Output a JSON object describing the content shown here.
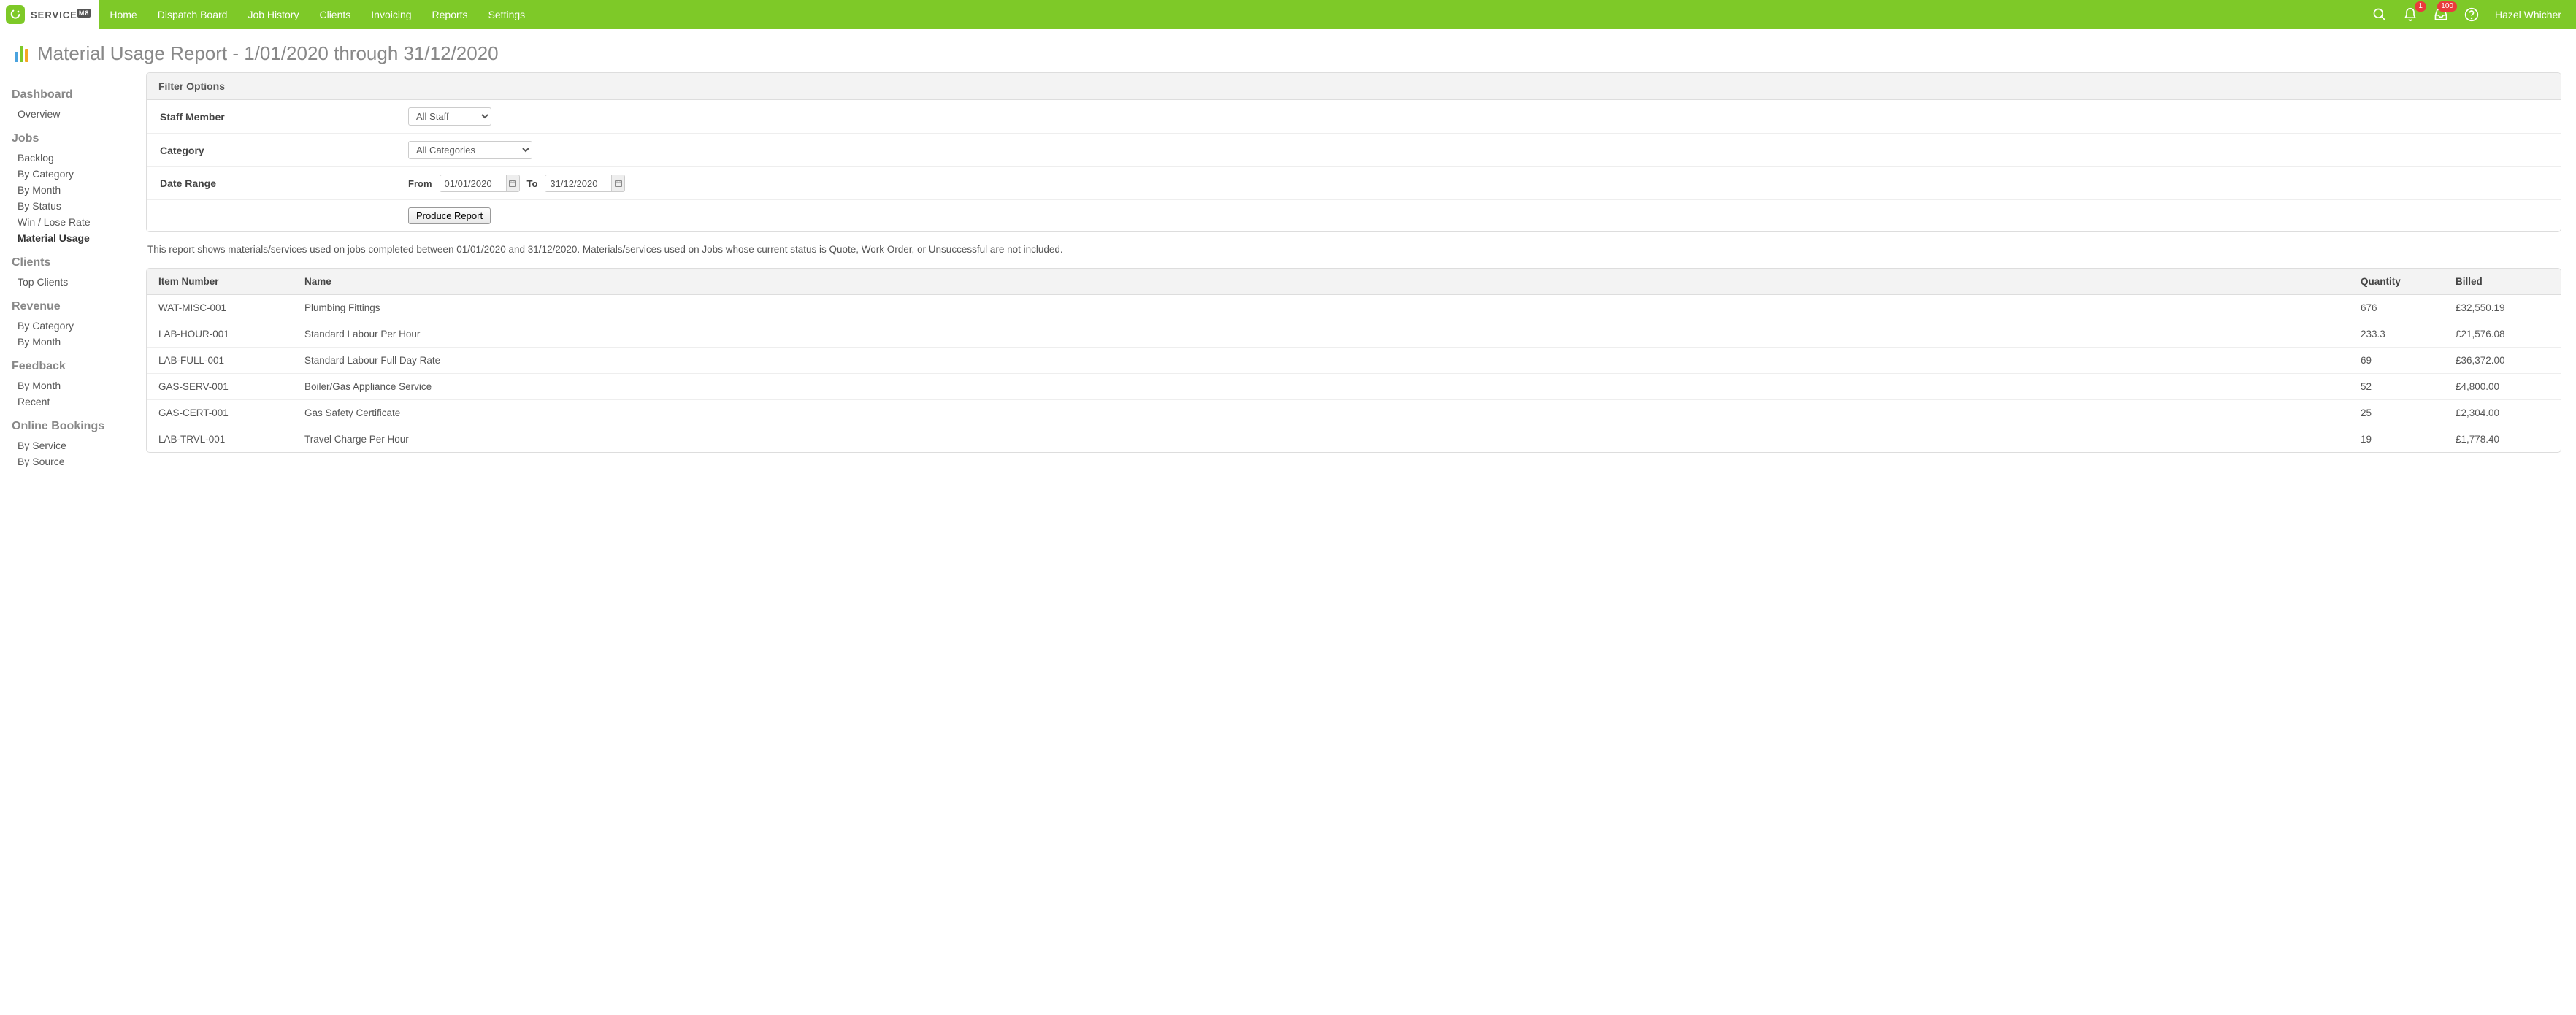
{
  "brand": {
    "text": "SERVICE",
    "suffix": "M8"
  },
  "nav": {
    "items": [
      "Home",
      "Dispatch Board",
      "Job History",
      "Clients",
      "Invoicing",
      "Reports",
      "Settings"
    ],
    "notif_badge": "1",
    "inbox_badge": "100",
    "username": "Hazel Whicher"
  },
  "page_title": "Material Usage Report - 1/01/2020 through 31/12/2020",
  "sidebar": {
    "groups": [
      {
        "title": "Dashboard",
        "items": [
          {
            "label": "Overview",
            "active": false
          }
        ]
      },
      {
        "title": "Jobs",
        "items": [
          {
            "label": "Backlog",
            "active": false
          },
          {
            "label": "By Category",
            "active": false
          },
          {
            "label": "By Month",
            "active": false
          },
          {
            "label": "By Status",
            "active": false
          },
          {
            "label": "Win / Lose Rate",
            "active": false
          },
          {
            "label": "Material Usage",
            "active": true
          }
        ]
      },
      {
        "title": "Clients",
        "items": [
          {
            "label": "Top Clients",
            "active": false
          }
        ]
      },
      {
        "title": "Revenue",
        "items": [
          {
            "label": "By Category",
            "active": false
          },
          {
            "label": "By Month",
            "active": false
          }
        ]
      },
      {
        "title": "Feedback",
        "items": [
          {
            "label": "By Month",
            "active": false
          },
          {
            "label": "Recent",
            "active": false
          }
        ]
      },
      {
        "title": "Online Bookings",
        "items": [
          {
            "label": "By Service",
            "active": false
          },
          {
            "label": "By Source",
            "active": false
          }
        ]
      }
    ]
  },
  "filter": {
    "header": "Filter Options",
    "staff_label": "Staff Member",
    "staff_value": "All Staff",
    "category_label": "Category",
    "category_value": "All Categories",
    "daterange_label": "Date Range",
    "from_label": "From",
    "from_value": "01/01/2020",
    "to_label": "To",
    "to_value": "31/12/2020",
    "produce_label": "Produce Report"
  },
  "note": "This report shows materials/services used on jobs completed between 01/01/2020 and 31/12/2020. Materials/services used on Jobs whose current status is Quote, Work Order, or Unsuccessful are not included.",
  "table": {
    "headers": {
      "item": "Item Number",
      "name": "Name",
      "qty": "Quantity",
      "billed": "Billed"
    },
    "rows": [
      {
        "item": "WAT-MISC-001",
        "name": "Plumbing Fittings",
        "qty": "676",
        "billed": "£32,550.19"
      },
      {
        "item": "LAB-HOUR-001",
        "name": "Standard Labour Per Hour",
        "qty": "233.3",
        "billed": "£21,576.08"
      },
      {
        "item": "LAB-FULL-001",
        "name": "Standard Labour Full Day Rate",
        "qty": "69",
        "billed": "£36,372.00"
      },
      {
        "item": "GAS-SERV-001",
        "name": "Boiler/Gas Appliance Service",
        "qty": "52",
        "billed": "£4,800.00"
      },
      {
        "item": "GAS-CERT-001",
        "name": "Gas Safety Certificate",
        "qty": "25",
        "billed": "£2,304.00"
      },
      {
        "item": "LAB-TRVL-001",
        "name": "Travel Charge Per Hour",
        "qty": "19",
        "billed": "£1,778.40"
      }
    ]
  }
}
